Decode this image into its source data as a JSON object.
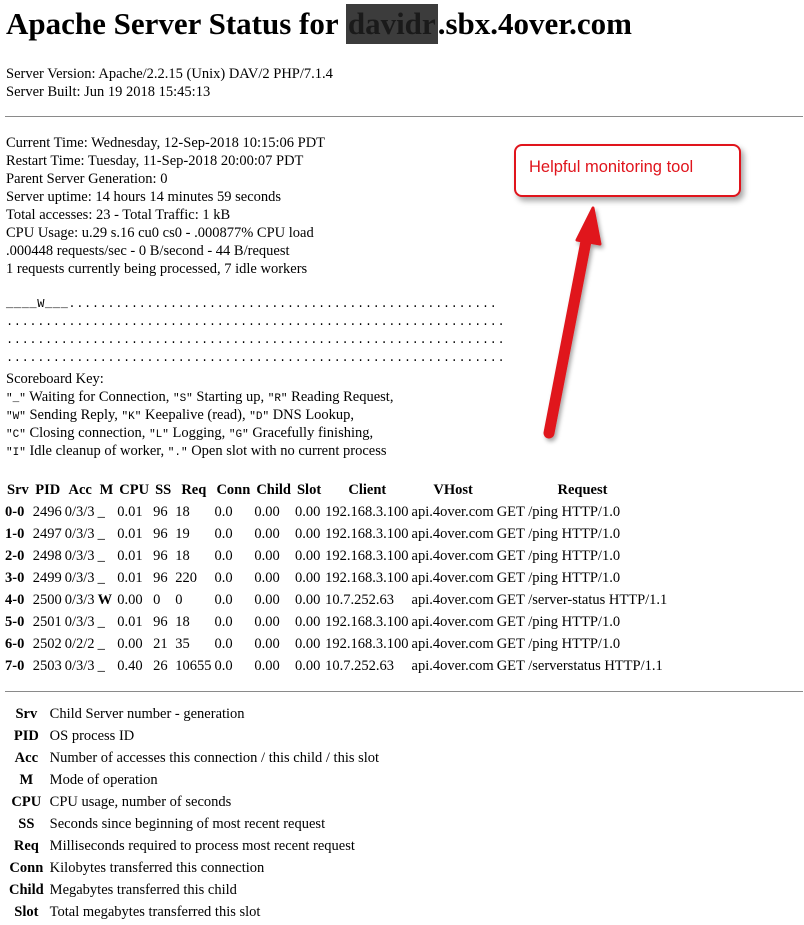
{
  "header": {
    "title_prefix": "Apache Server Status for",
    "title_redacted": "davidr",
    "title_suffix": ".sbx.4over.com"
  },
  "server_info": [
    "Server Version: Apache/2.2.15 (Unix) DAV/2 PHP/7.1.4",
    "Server Built: Jun 19 2018 15:45:13"
  ],
  "status_lines": [
    "Current Time: Wednesday, 12-Sep-2018 10:15:06 PDT",
    "Restart Time: Tuesday, 11-Sep-2018 20:00:07 PDT",
    "Parent Server Generation: 0",
    "Server uptime: 14 hours 14 minutes 59 seconds",
    "Total accesses: 23 - Total Traffic: 1 kB",
    "CPU Usage: u.29 s.16 cu0 cs0 - .000877% CPU load",
    ".000448 requests/sec - 0 B/second - 44 B/request",
    "1 requests currently being processed, 7 idle workers"
  ],
  "scoreboard": [
    "____W___.......................................................",
    "................................................................",
    "................................................................",
    "................................................................"
  ],
  "scoreboard_key": {
    "title": "Scoreboard Key:",
    "lines": [
      [
        {
          "c": "\"_\""
        },
        {
          "t": " Waiting for Connection, "
        },
        {
          "c": "\"S\""
        },
        {
          "t": " Starting up, "
        },
        {
          "c": "\"R\""
        },
        {
          "t": " Reading Request,"
        }
      ],
      [
        {
          "c": "\"W\""
        },
        {
          "t": " Sending Reply, "
        },
        {
          "c": "\"K\""
        },
        {
          "t": " Keepalive (read), "
        },
        {
          "c": "\"D\""
        },
        {
          "t": " DNS Lookup,"
        }
      ],
      [
        {
          "c": "\"C\""
        },
        {
          "t": " Closing connection, "
        },
        {
          "c": "\"L\""
        },
        {
          "t": " Logging, "
        },
        {
          "c": "\"G\""
        },
        {
          "t": " Gracefully finishing,"
        }
      ],
      [
        {
          "c": "\"I\""
        },
        {
          "t": " Idle cleanup of worker, "
        },
        {
          "c": "\".\""
        },
        {
          "t": " Open slot with no current process"
        }
      ]
    ]
  },
  "workers": {
    "columns": [
      "Srv",
      "PID",
      "Acc",
      "M",
      "CPU",
      "SS",
      "Req",
      "Conn",
      "Child",
      "Slot",
      "Client",
      "VHost",
      "Request"
    ],
    "rows": [
      [
        "0-0",
        "2496",
        "0/3/3",
        "_",
        "0.01",
        "96",
        "18",
        "0.0",
        "0.00",
        "0.00",
        "192.168.3.100",
        "api.4over.com",
        "GET /ping HTTP/1.0"
      ],
      [
        "1-0",
        "2497",
        "0/3/3",
        "_",
        "0.01",
        "96",
        "19",
        "0.0",
        "0.00",
        "0.00",
        "192.168.3.100",
        "api.4over.com",
        "GET /ping HTTP/1.0"
      ],
      [
        "2-0",
        "2498",
        "0/3/3",
        "_",
        "0.01",
        "96",
        "18",
        "0.0",
        "0.00",
        "0.00",
        "192.168.3.100",
        "api.4over.com",
        "GET /ping HTTP/1.0"
      ],
      [
        "3-0",
        "2499",
        "0/3/3",
        "_",
        "0.01",
        "96",
        "220",
        "0.0",
        "0.00",
        "0.00",
        "192.168.3.100",
        "api.4over.com",
        "GET /ping HTTP/1.0"
      ],
      [
        "4-0",
        "2500",
        "0/3/3",
        "W",
        "0.00",
        "0",
        "0",
        "0.0",
        "0.00",
        "0.00",
        "10.7.252.63",
        "api.4over.com",
        "GET /server-status HTTP/1.1"
      ],
      [
        "5-0",
        "2501",
        "0/3/3",
        "_",
        "0.01",
        "96",
        "18",
        "0.0",
        "0.00",
        "0.00",
        "192.168.3.100",
        "api.4over.com",
        "GET /ping HTTP/1.0"
      ],
      [
        "6-0",
        "2502",
        "0/2/2",
        "_",
        "0.00",
        "21",
        "35",
        "0.0",
        "0.00",
        "0.00",
        "192.168.3.100",
        "api.4over.com",
        "GET /ping HTTP/1.0"
      ],
      [
        "7-0",
        "2503",
        "0/3/3",
        "_",
        "0.40",
        "26",
        "10655",
        "0.0",
        "0.00",
        "0.00",
        "10.7.252.63",
        "api.4over.com",
        "GET /serverstatus HTTP/1.1"
      ]
    ]
  },
  "legend": [
    {
      "key": "Srv",
      "desc": "Child Server number - generation"
    },
    {
      "key": "PID",
      "desc": "OS process ID"
    },
    {
      "key": "Acc",
      "desc": "Number of accesses this connection / this child / this slot"
    },
    {
      "key": "M",
      "desc": "Mode of operation"
    },
    {
      "key": "CPU",
      "desc": "CPU usage, number of seconds"
    },
    {
      "key": "SS",
      "desc": "Seconds since beginning of most recent request"
    },
    {
      "key": "Req",
      "desc": "Milliseconds required to process most recent request"
    },
    {
      "key": "Conn",
      "desc": "Kilobytes transferred this connection"
    },
    {
      "key": "Child",
      "desc": "Megabytes transferred this child"
    },
    {
      "key": "Slot",
      "desc": "Total megabytes transferred this slot"
    }
  ],
  "annotation": {
    "text": "Helpful monitoring tool",
    "color": "#e0141c"
  }
}
